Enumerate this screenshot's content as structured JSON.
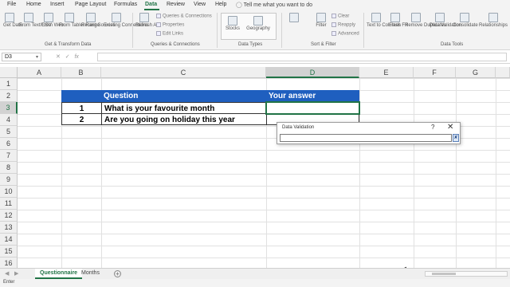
{
  "menu": {
    "tabs": [
      "File",
      "Home",
      "Insert",
      "Page Layout",
      "Formulas",
      "Data",
      "Review",
      "View",
      "Help"
    ],
    "active_tab": "Data",
    "tell_me": "Tell me what you want to do"
  },
  "ribbon": {
    "buttons": {
      "get_data": "Get Data",
      "from_text": "From Text/CSV",
      "from_web": "From Web",
      "from_table": "From Table/ Range",
      "recent_sources": "Recent Sources",
      "existing_connections": "Existing Connections",
      "refresh_all": "Refresh All",
      "stocks": "Stocks",
      "geography": "Geography",
      "filter": "Filter",
      "text_to_columns": "Text to Columns",
      "flash_fill": "Flash Fill",
      "remove_duplicates": "Remove Duplicates",
      "data_validation": "Data Validation",
      "consolidate": "Consolidate",
      "relationships": "Relationships"
    },
    "small": {
      "queries_connections": "Queries & Connections",
      "properties": "Properties",
      "edit_links": "Edit Links",
      "clear": "Clear",
      "reapply": "Reapply",
      "advanced": "Advanced"
    },
    "groups": {
      "get_transform": "Get & Transform Data",
      "queries": "Queries & Connections",
      "data_types": "Data Types",
      "sort_filter": "Sort & Filter",
      "data_tools": "Data Tools"
    }
  },
  "formula_bar": {
    "name_box": "D3",
    "fx": "fx",
    "formula": ""
  },
  "columns": [
    "A",
    "B",
    "C",
    "D",
    "E",
    "F",
    "G"
  ],
  "rows": [
    "1",
    "2",
    "3",
    "4",
    "5",
    "6",
    "7",
    "8",
    "9",
    "10",
    "11",
    "12",
    "13",
    "14",
    "15",
    "16"
  ],
  "table": {
    "header_question": "Question",
    "header_answer": "Your answer",
    "rows": [
      {
        "num": "1",
        "question": "What is your favourite month"
      },
      {
        "num": "2",
        "question": "Are you going on holiday this year"
      }
    ]
  },
  "dialog": {
    "title": "Data Validation",
    "help": "?",
    "close": "✕",
    "input_value": ""
  },
  "sheets": {
    "tabs": [
      "Questionnaire",
      "Months"
    ],
    "active": "Questionnaire",
    "add": "+"
  },
  "status": {
    "mode": "Enter"
  },
  "colors": {
    "accent": "#217346",
    "header_fill": "#1f5fbf"
  }
}
